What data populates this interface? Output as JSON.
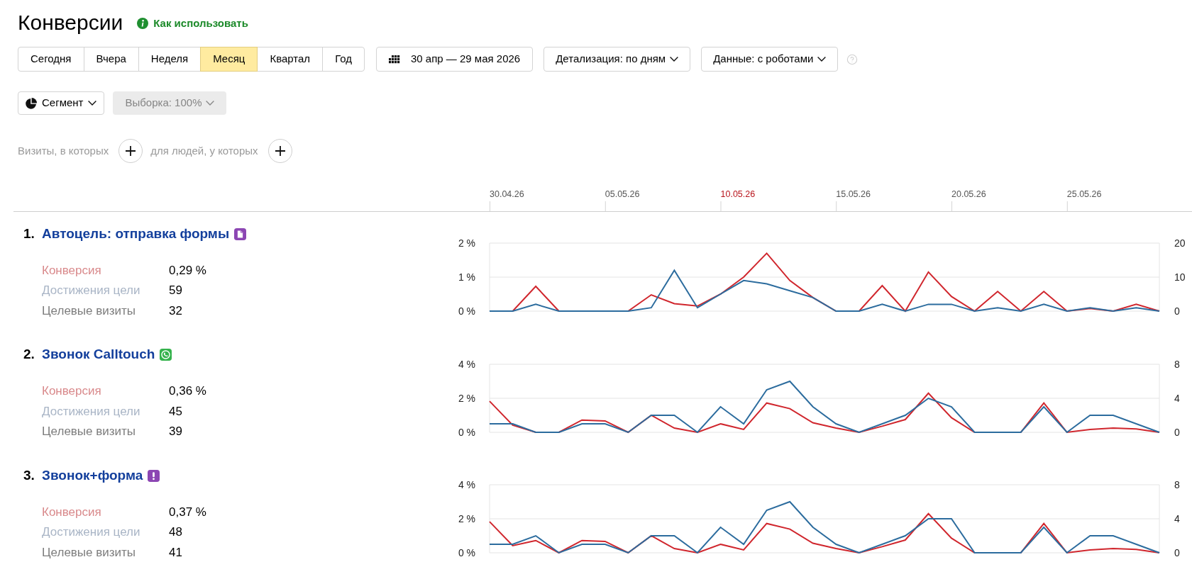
{
  "header": {
    "title": "Конверсии",
    "help_link": "Как использовать"
  },
  "periods": [
    {
      "label": "Сегодня",
      "selected": false
    },
    {
      "label": "Вчера",
      "selected": false
    },
    {
      "label": "Неделя",
      "selected": false
    },
    {
      "label": "Месяц",
      "selected": true
    },
    {
      "label": "Квартал",
      "selected": false
    },
    {
      "label": "Год",
      "selected": false
    }
  ],
  "date_range": "30 апр — 29 мая 2026",
  "dropdowns": [
    {
      "label": "Детализация: по дням"
    },
    {
      "label": "Данные: с роботами"
    }
  ],
  "segment": {
    "label": "Сегмент"
  },
  "sampling": {
    "label": "Выборка: 100%",
    "disabled": true
  },
  "filters": [
    {
      "label": "Визиты, в которых"
    },
    {
      "label": "для людей, у которых"
    }
  ],
  "timeline": {
    "ticks": [
      {
        "label": "30.04.26",
        "weekend": false
      },
      {
        "label": "05.05.26",
        "weekend": false
      },
      {
        "label": "10.05.26",
        "weekend": true
      },
      {
        "label": "15.05.26",
        "weekend": false
      },
      {
        "label": "20.05.26",
        "weekend": false
      },
      {
        "label": "25.05.26",
        "weekend": false
      }
    ]
  },
  "goals": [
    {
      "number": "1.",
      "title": "Автоцель: отправка формы",
      "kind": "form",
      "metrics": [
        {
          "label": "Конверсия",
          "value": "0,29 %",
          "color": "#d98a8c"
        },
        {
          "label": "Достижения цели",
          "value": "59",
          "color": "#a9b5c6"
        },
        {
          "label": "Целевые визиты",
          "value": "32",
          "color": "#7d7d7d"
        }
      ],
      "chart_data": {
        "type": "line",
        "ylim": [
          0,
          2
        ],
        "yticks": [
          {
            "value": 0,
            "label": "0 %"
          },
          {
            "value": 1,
            "label": "1 %"
          },
          {
            "value": 2,
            "label": "2 %"
          }
        ],
        "y2lim": [
          0,
          20
        ],
        "y2ticks": [
          0,
          10,
          20
        ],
        "series": [
          {
            "color": "#d0262d",
            "values": [
              0,
              0,
              0.73,
              0,
              0,
              0,
              0,
              0.48,
              0.22,
              0.15,
              0.5,
              1.0,
              1.7,
              0.9,
              0.4,
              0,
              0,
              0.75,
              0,
              1.15,
              0.43,
              0,
              0.58,
              0,
              0.58,
              0,
              0.08,
              0,
              0.2,
              0
            ]
          },
          {
            "color": "#2c6c9e",
            "axis": "y2",
            "values": [
              0,
              0,
              2,
              0,
              0,
              0,
              0,
              1,
              12,
              1,
              5,
              9,
              8,
              6,
              4,
              0,
              0,
              2,
              0,
              2,
              2,
              0,
              1,
              0,
              2,
              0,
              1,
              0,
              1,
              0
            ]
          }
        ]
      }
    },
    {
      "number": "2.",
      "title": "Звонок Calltouch",
      "kind": "call",
      "metrics": [
        {
          "label": "Конверсия",
          "value": "0,36 %",
          "color": "#d98a8c"
        },
        {
          "label": "Достижения цели",
          "value": "45",
          "color": "#a9b5c6"
        },
        {
          "label": "Целевые визиты",
          "value": "39",
          "color": "#7d7d7d"
        }
      ],
      "chart_data": {
        "type": "line",
        "ylim": [
          0,
          4
        ],
        "yticks": [
          {
            "value": 0,
            "label": "0 %"
          },
          {
            "value": 2,
            "label": "2 %"
          },
          {
            "value": 4,
            "label": "4 %"
          }
        ],
        "y2lim": [
          0,
          8
        ],
        "y2ticks": [
          0,
          4,
          8
        ],
        "series": [
          {
            "color": "#d0262d",
            "values": [
              1.83,
              0.42,
              0,
              0,
              0.72,
              0.67,
              0,
              1.0,
              0.25,
              0,
              0.5,
              0.17,
              1.72,
              1.39,
              0.56,
              0.25,
              0,
              0.36,
              0.75,
              2.3,
              0.86,
              0,
              0,
              0,
              1.72,
              0,
              0.17,
              0.25,
              0.2,
              0
            ]
          },
          {
            "color": "#2c6c9e",
            "axis": "y2",
            "values": [
              1,
              1,
              0,
              0,
              1,
              1,
              0,
              2,
              2,
              0,
              3,
              1,
              5,
              6,
              3,
              1,
              0,
              1,
              2,
              4,
              3,
              0,
              0,
              0,
              3,
              0,
              2,
              2,
              1,
              0
            ]
          }
        ]
      }
    },
    {
      "number": "3.",
      "title": "Звонок+форма",
      "kind": "composite",
      "metrics": [
        {
          "label": "Конверсия",
          "value": "0,37 %",
          "color": "#d98a8c"
        },
        {
          "label": "Достижения цели",
          "value": "48",
          "color": "#a9b5c6"
        },
        {
          "label": "Целевые визиты",
          "value": "41",
          "color": "#7d7d7d"
        }
      ],
      "chart_data": {
        "type": "line",
        "ylim": [
          0,
          4
        ],
        "yticks": [
          {
            "value": 0,
            "label": "0 %"
          },
          {
            "value": 2,
            "label": "2 %"
          },
          {
            "value": 4,
            "label": "4 %"
          }
        ],
        "y2lim": [
          0,
          8
        ],
        "y2ticks": [
          0,
          4,
          8
        ],
        "series": [
          {
            "color": "#d0262d",
            "values": [
              1.83,
              0.42,
              0.72,
              0,
              0.72,
              0.67,
              0,
              1.0,
              0.25,
              0,
              0.5,
              0.17,
              1.72,
              1.39,
              0.56,
              0.25,
              0,
              0.36,
              0.75,
              2.3,
              0.86,
              0,
              0,
              0,
              1.72,
              0,
              0.17,
              0.25,
              0.2,
              0
            ]
          },
          {
            "color": "#2c6c9e",
            "axis": "y2",
            "values": [
              1,
              1,
              2,
              0,
              1,
              1,
              0,
              2,
              2,
              0,
              3,
              1,
              5,
              6,
              3,
              1,
              0,
              1,
              2,
              4,
              4,
              0,
              0,
              0,
              3,
              0,
              2,
              2,
              1,
              0
            ]
          }
        ]
      }
    }
  ]
}
